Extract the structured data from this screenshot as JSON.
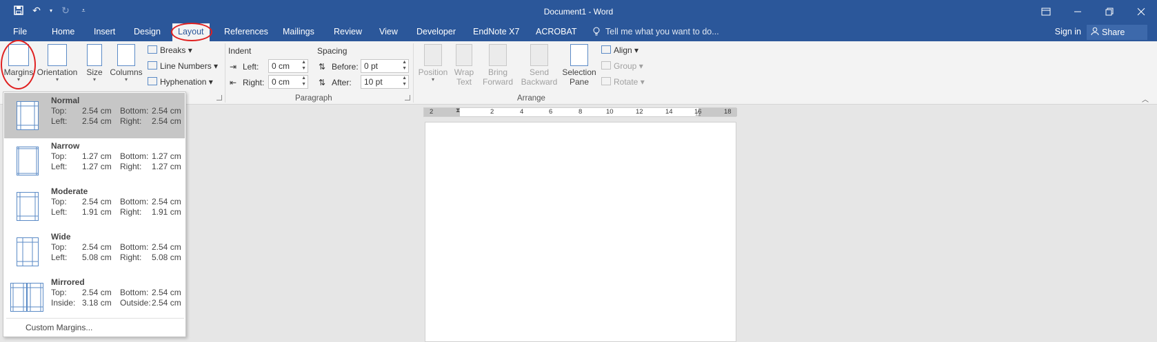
{
  "window": {
    "title": "Document1 - Word",
    "qat": [
      "save-icon",
      "undo-icon",
      "redo-icon",
      "customize-qat-icon"
    ],
    "controls": [
      "ribbon-display-options-icon",
      "minimize-icon",
      "restore-icon",
      "close-icon"
    ]
  },
  "tabs": [
    {
      "name": "file",
      "label": "File"
    },
    {
      "name": "home",
      "label": "Home"
    },
    {
      "name": "insert",
      "label": "Insert"
    },
    {
      "name": "design",
      "label": "Design"
    },
    {
      "name": "layout",
      "label": "Layout",
      "active": true
    },
    {
      "name": "references",
      "label": "References"
    },
    {
      "name": "mailings",
      "label": "Mailings"
    },
    {
      "name": "review",
      "label": "Review"
    },
    {
      "name": "view",
      "label": "View"
    },
    {
      "name": "developer",
      "label": "Developer"
    },
    {
      "name": "endnote",
      "label": "EndNote X7"
    },
    {
      "name": "acrobat",
      "label": "ACROBAT"
    }
  ],
  "tellme": "Tell me what you want to do...",
  "signin": "Sign in",
  "share": "Share",
  "page_setup": {
    "margins": "Margins",
    "orientation": "Orientation",
    "size": "Size",
    "columns": "Columns",
    "breaks": "Breaks",
    "line_numbers": "Line Numbers",
    "hyphenation": "Hyphenation"
  },
  "paragraph": {
    "group_label": "Paragraph",
    "indent_label": "Indent",
    "spacing_label": "Spacing",
    "left_label": "Left:",
    "left_value": "0 cm",
    "right_label": "Right:",
    "right_value": "0 cm",
    "before_label": "Before:",
    "before_value": "0 pt",
    "after_label": "After:",
    "after_value": "10 pt"
  },
  "arrange": {
    "group_label": "Arrange",
    "position": "Position",
    "wrap_text_1": "Wrap",
    "wrap_text_2": "Text",
    "bring_forward_1": "Bring",
    "bring_forward_2": "Forward",
    "send_backward_1": "Send",
    "send_backward_2": "Backward",
    "selection_pane_1": "Selection",
    "selection_pane_2": "Pane",
    "align": "Align",
    "group": "Group",
    "rotate": "Rotate"
  },
  "ruler": [
    "2",
    "2",
    "4",
    "6",
    "8",
    "10",
    "12",
    "14",
    "16",
    "18"
  ],
  "margins_menu": {
    "options": [
      {
        "name": "Normal",
        "top_label": "Top:",
        "top": "2.54 cm",
        "bottom_label": "Bottom:",
        "bottom": "2.54 cm",
        "left_label": "Left:",
        "left": "2.54 cm",
        "right_label": "Right:",
        "right": "2.54 cm",
        "selected": true
      },
      {
        "name": "Narrow",
        "top_label": "Top:",
        "top": "1.27 cm",
        "bottom_label": "Bottom:",
        "bottom": "1.27 cm",
        "left_label": "Left:",
        "left": "1.27 cm",
        "right_label": "Right:",
        "right": "1.27 cm"
      },
      {
        "name": "Moderate",
        "top_label": "Top:",
        "top": "2.54 cm",
        "bottom_label": "Bottom:",
        "bottom": "2.54 cm",
        "left_label": "Left:",
        "left": "1.91 cm",
        "right_label": "Right:",
        "right": "1.91 cm"
      },
      {
        "name": "Wide",
        "top_label": "Top:",
        "top": "2.54 cm",
        "bottom_label": "Bottom:",
        "bottom": "2.54 cm",
        "left_label": "Left:",
        "left": "5.08 cm",
        "right_label": "Right:",
        "right": "5.08 cm"
      },
      {
        "name": "Mirrored",
        "top_label": "Top:",
        "top": "2.54 cm",
        "bottom_label": "Bottom:",
        "bottom": "2.54 cm",
        "left_label": "Inside:",
        "left": "3.18 cm",
        "right_label": "Outside:",
        "right": "2.54 cm"
      }
    ],
    "custom": "Custom Margins..."
  },
  "colors": {
    "brand": "#2b579a",
    "annotation": "#e02020",
    "selected_option": "#c6c6c6"
  }
}
